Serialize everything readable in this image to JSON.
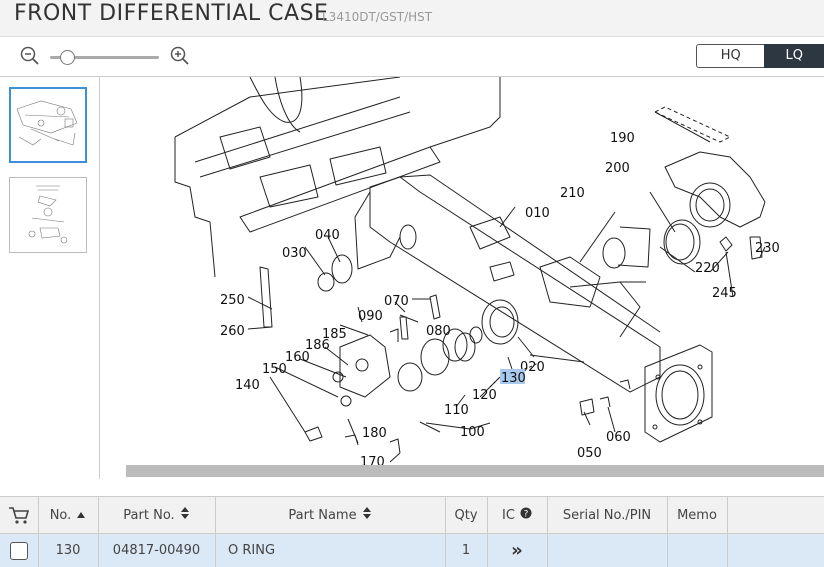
{
  "header": {
    "title": "FRONT DIFFERENTIAL CASE",
    "model": "L3410DT/GST/HST"
  },
  "toolbar": {
    "zoom_out_icon": "zoom-out-icon",
    "zoom_in_icon": "zoom-in-icon",
    "zoom_level": 0.15,
    "quality": {
      "hq_label": "HQ",
      "lq_label": "LQ",
      "selected": "LQ"
    }
  },
  "diagram": {
    "part_labels": {
      "p010": "010",
      "p020": "020",
      "p030": "030",
      "p040": "040",
      "p050": "050",
      "p060": "060",
      "p070": "070",
      "p080": "080",
      "p090": "090",
      "p100": "100",
      "p110": "110",
      "p120": "120",
      "p130": "130",
      "p140": "140",
      "p150": "150",
      "p160": "160",
      "p170": "170",
      "p180": "180",
      "p185": "185",
      "p186": "186",
      "p190": "190",
      "p200": "200",
      "p210": "210",
      "p220": "220",
      "p230": "230",
      "p245": "245",
      "p250": "250",
      "p260": "260"
    },
    "highlighted": "130",
    "highlight_color": "#a9c8ee"
  },
  "table": {
    "headers": {
      "no": "No.",
      "part_no": "Part No.",
      "part_name": "Part Name",
      "qty": "Qty",
      "ic": "IC",
      "serial": "Serial No./PIN",
      "memo": "Memo"
    },
    "rows": [
      {
        "no": "130",
        "part_no": "04817-00490",
        "part_name": "O RING",
        "qty": "1",
        "ic": "»",
        "serial": "",
        "memo": ""
      }
    ],
    "row_selected_color": "#dbe8f6"
  }
}
